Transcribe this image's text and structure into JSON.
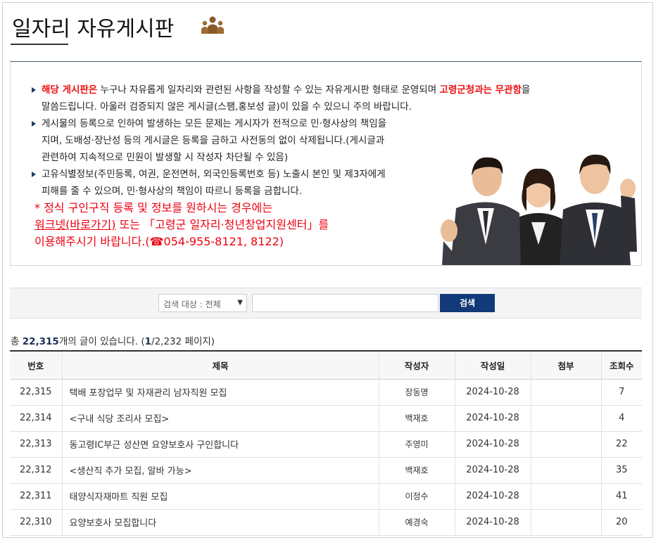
{
  "page": {
    "title": "일자리 자유게시판"
  },
  "notice": {
    "b1_highlight": "해당 게시판은",
    "b1_text": " 누구나 자유롭게 일자리와 관련된 사항을 작성할 수 있는 자유게시판 형태로 운영되며 ",
    "b1_highlight2": "고령군청과는 무관함",
    "b1_text2": "을",
    "b1_line2": "말씀드립니다. 아울러 검증되지 않은 게시글(스팸,홍보성 글)이 있을 수 있으니 주의 바랍니다.",
    "b2_line1": "게시물의 등록으로 인하여 발생하는 모든 문제는 게시자가 전적으로 민·형사상의 책임을",
    "b2_line2": "지며, 도배성·장난성 등의 게시글은 등록을 금하고 사전동의 없이 삭제됩니다.(게시글과",
    "b2_line3": "관련하여 지속적으로 민원이 발생할 시 작성자 차단될 수 있음)",
    "b3_line1": "고유식별정보(주민등록, 여권, 운전면허, 외국인등록번호 등) 노출시 본인 및 제3자에게",
    "b3_line2": "피해를 줄 수 있으며, 민·형사상의 책임이 따르니 등록을 금합니다.",
    "red_line1": "* 정식 구인구직 등록 및 정보를 원하시는 경우에는",
    "red_link": "워크넷(바로가기)",
    "red_line2_rest": " 또는 「고령군 일자리·청년창업지원센터」를",
    "red_line3": "이용해주시기 바랍니다.(☎054-955-8121, 8122)"
  },
  "search": {
    "select_value": "검색 대상 : 전체",
    "input_value": "",
    "button_label": "검색"
  },
  "summary": {
    "prefix": "총 ",
    "total": "22,315",
    "mid": "개의 글이 있습니다. (",
    "page": "1",
    "suffix": "/2,232 페이지)"
  },
  "table": {
    "headers": [
      "번호",
      "제목",
      "작성자",
      "작성일",
      "첨부",
      "조회수"
    ],
    "rows": [
      {
        "no": "22,315",
        "subject": "택배 포장업무 및 자재관리 남자직원 모집",
        "author": "장동명",
        "date": "2024-10-28",
        "attach": "",
        "views": "7"
      },
      {
        "no": "22,314",
        "subject": "<구내 식당 조리사 모집>",
        "author": "백재호",
        "date": "2024-10-28",
        "attach": "",
        "views": "4"
      },
      {
        "no": "22,313",
        "subject": "동고령IC부근 성산면 요양보호사 구인합니다",
        "author": "주영미",
        "date": "2024-10-28",
        "attach": "",
        "views": "22"
      },
      {
        "no": "22,312",
        "subject": "<생산직 추가 모집, 알바 가능>",
        "author": "백재호",
        "date": "2024-10-28",
        "attach": "",
        "views": "35"
      },
      {
        "no": "22,311",
        "subject": "태양식자재마트 직원 모집",
        "author": "이정수",
        "date": "2024-10-28",
        "attach": "",
        "views": "41"
      },
      {
        "no": "22,310",
        "subject": "요양보호사 모집합니다",
        "author": "예경숙",
        "date": "2024-10-28",
        "attach": "",
        "views": "20"
      }
    ]
  }
}
